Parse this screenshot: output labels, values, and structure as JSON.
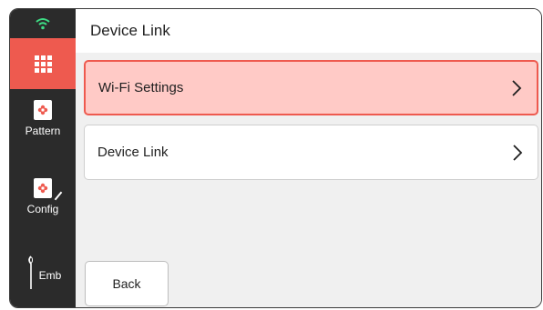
{
  "sidebar": {
    "items": [
      {
        "label": "Pattern",
        "icon": "pattern-icon"
      },
      {
        "label": "Config",
        "icon": "config-icon"
      },
      {
        "label": "Emb",
        "icon": "needle-icon"
      }
    ],
    "status_icon": "wifi-icon",
    "home_icon": "apps-grid-icon"
  },
  "header": {
    "title": "Device Link"
  },
  "menu": {
    "items": [
      {
        "label": "Wi-Fi Settings",
        "selected": true
      },
      {
        "label": "Device Link",
        "selected": false
      }
    ]
  },
  "footer": {
    "back_label": "Back"
  },
  "colors": {
    "accent": "#ee5a4f",
    "selected_bg": "#ffcac6",
    "sidebar_bg": "#2b2b2b",
    "wifi": "#3ddc84"
  }
}
